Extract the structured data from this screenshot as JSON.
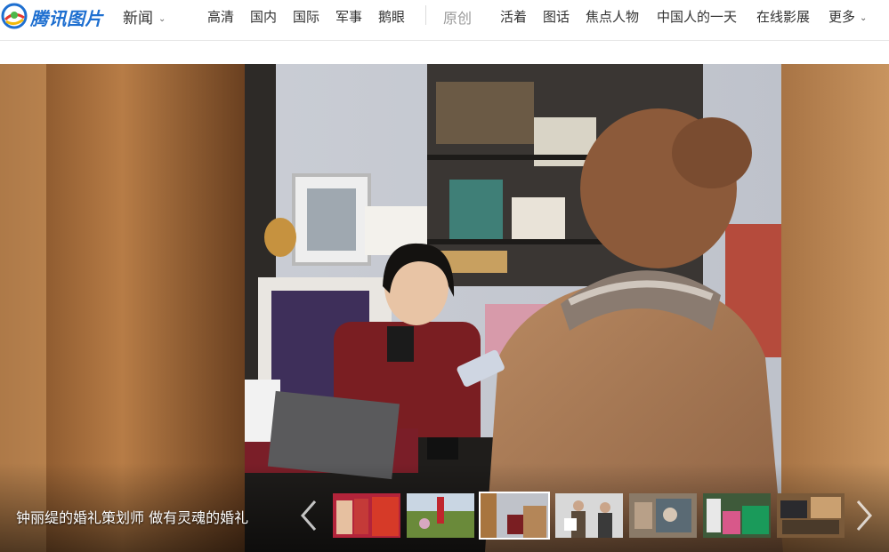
{
  "logo": {
    "text": "腾讯图片"
  },
  "channel": {
    "label": "新闻"
  },
  "nav": {
    "items": [
      "高清",
      "国内",
      "国际",
      "军事",
      "鹅眼"
    ],
    "original_label": "原创",
    "items2": [
      "活着",
      "图话",
      "焦点人物",
      "中国人的一天",
      "在线影展"
    ],
    "more_label": "更多"
  },
  "slide": {
    "caption": "钟丽缇的婚礼策划师 做有灵魂的婚礼",
    "active_thumb_index": 2,
    "thumb_count": 7
  },
  "colors": {
    "brand_blue": "#1e6fd0",
    "nav_text": "#333333",
    "muted_text": "#999999"
  }
}
